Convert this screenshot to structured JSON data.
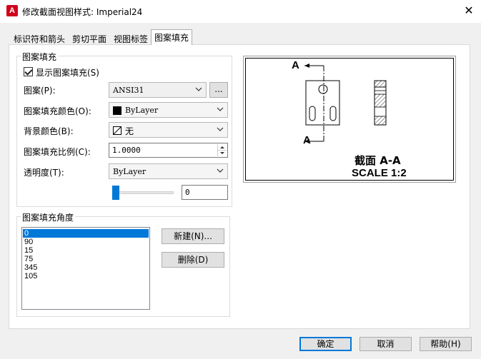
{
  "window": {
    "title": "修改截面视图样式: Imperial24",
    "app_icon_letter": "A",
    "close_glyph": "✕"
  },
  "tabs": [
    {
      "label": "标识符和箭头",
      "active": false
    },
    {
      "label": "剪切平面",
      "active": false
    },
    {
      "label": "视图标签",
      "active": false
    },
    {
      "label": "图案填充",
      "active": true
    }
  ],
  "hatch": {
    "group_title": "图案填充",
    "show_hatch_label": "显示图案填充(S)",
    "show_hatch_checked": true,
    "pattern_label": "图案(P):",
    "pattern_value": "ANSI31",
    "browse_label": "...",
    "hatch_color_label": "图案填充颜色(O):",
    "hatch_color_value": "ByLayer",
    "bg_color_label": "背景颜色(B):",
    "bg_color_value": "无",
    "scale_label": "图案填充比例(C):",
    "scale_value": "1.0000",
    "transparency_label": "透明度(T):",
    "transparency_value": "ByLayer",
    "transparency_level": 0,
    "transparency_number": "0"
  },
  "angle": {
    "group_title": "图案填充角度",
    "items": [
      "0",
      "90",
      "15",
      "75",
      "345",
      "105"
    ],
    "selected_index": 0,
    "new_button": "新建(N)...",
    "delete_button": "删除(D)"
  },
  "preview": {
    "label_a_top": "A",
    "label_a_bottom": "A",
    "caption_line1": "截面 A-A",
    "caption_line2": "SCALE 1:2"
  },
  "footer": {
    "ok": "确定",
    "cancel": "取消",
    "help": "帮助(H)"
  },
  "colors": {
    "accent": "#0078d7",
    "app_icon": "#d0021b"
  }
}
